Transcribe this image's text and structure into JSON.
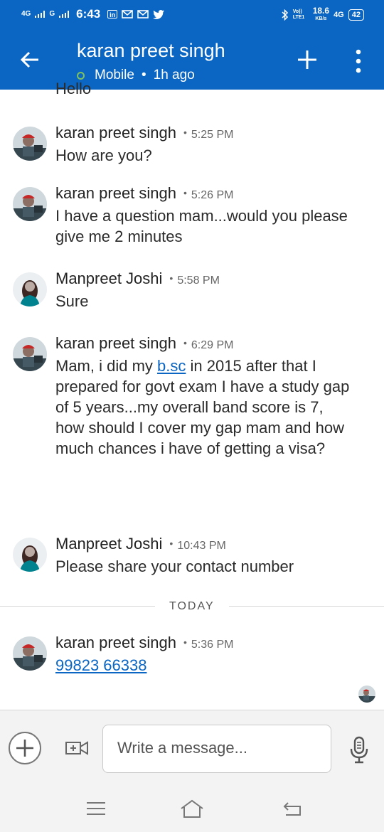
{
  "status_bar": {
    "signal_1": "4G",
    "signal_2": "G",
    "time": "6:43",
    "speed_value": "18.6",
    "speed_unit": "KB/s",
    "network": "4G",
    "volte": "Vo)) LTE1",
    "battery": "42"
  },
  "header": {
    "title": "karan preet singh",
    "presence": "Mobile",
    "separator": "•",
    "last_seen": "1h ago",
    "accent_color": "#0a66c2",
    "online_color": "#7fc15e"
  },
  "partial_message": "Hello",
  "messages": [
    {
      "sender": "karan preet singh",
      "time": "5:25 PM",
      "text": "How are you?"
    },
    {
      "sender": "karan preet singh",
      "time": "5:26 PM",
      "text": "I have a question mam...would you please give me 2 minutes"
    },
    {
      "sender": "Manpreet Joshi",
      "time": "5:58 PM",
      "text": "Sure"
    },
    {
      "sender": "karan preet singh",
      "time": "6:29 PM",
      "text_before": "Mam, i did my ",
      "link": "b.sc",
      "text_after": " in 2015 after that I prepared for govt exam I have a study gap of 5 years...my overall band score is 7, how should I cover my gap mam and how much chances i have of getting a visa?"
    },
    {
      "sender": "Manpreet Joshi",
      "time": "10:43 PM",
      "text": "Please share your contact number"
    },
    {
      "sender": "karan preet singh",
      "time": "5:36 PM",
      "phone": "99823 66338"
    }
  ],
  "dot": "•",
  "day_divider": "TODAY",
  "composer": {
    "placeholder": "Write a message..."
  },
  "icons": {
    "back": "arrow-left-icon",
    "add": "plus-icon",
    "more": "kebab-menu-icon",
    "attach": "plus-circle-icon",
    "video": "video-call-icon",
    "mic": "microphone-icon"
  }
}
